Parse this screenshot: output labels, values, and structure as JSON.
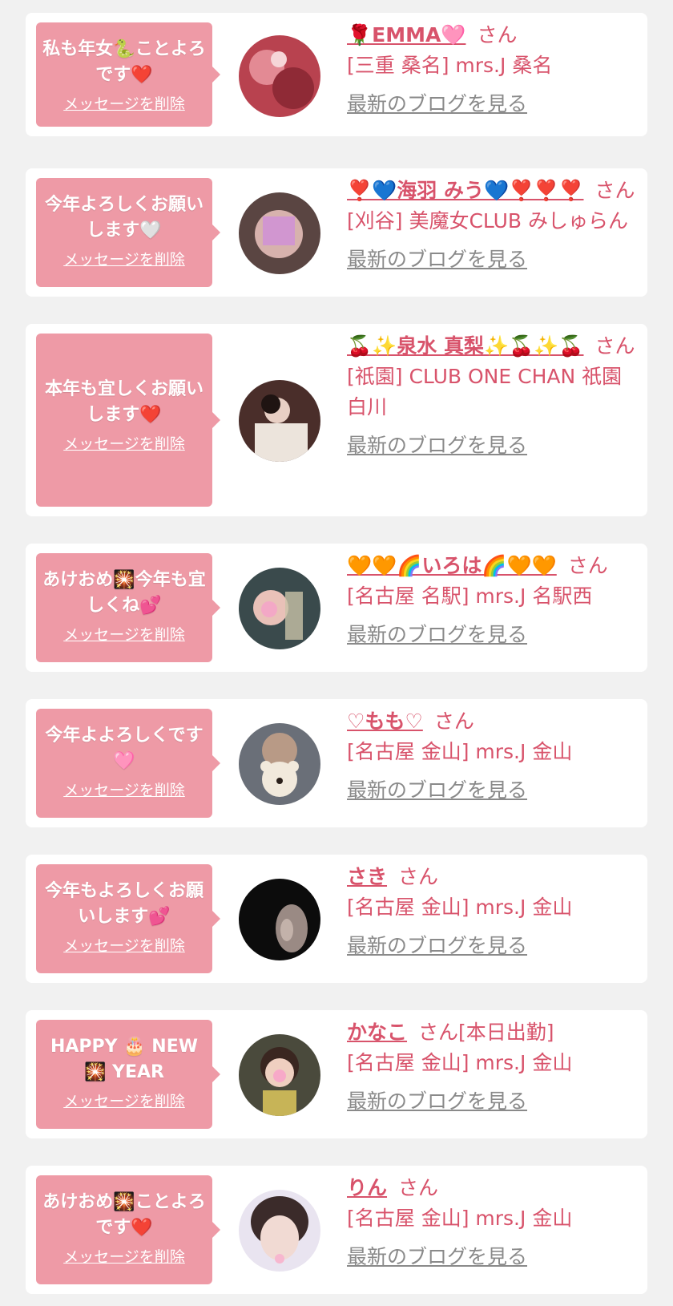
{
  "colors": {
    "background": "#f1f1f1",
    "card": "#ffffff",
    "bubble": "#ee9aa6",
    "accent": "#d8536b",
    "link_gray": "#8a8a8a"
  },
  "cards": [
    {
      "message": "私も年女🐍ことよろです❤️",
      "delete_label": "メッセージを削除",
      "name": "🌹EMMA🩷",
      "honorific": "さん",
      "status": "",
      "shop": "[三重 桑名] mrs.J 桑名",
      "blog_label": "最新のブログを見る"
    },
    {
      "message": "今年よろしくお願いします🤍",
      "delete_label": "メッセージを削除",
      "name": "❣️💙海羽 みう💙❣️❣️❣️",
      "honorific": "さん",
      "status": "",
      "shop": "[刈谷] 美魔女CLUB みしゅらん",
      "blog_label": "最新のブログを見る"
    },
    {
      "message": "本年も宜しくお願いします❤️",
      "delete_label": "メッセージを削除",
      "name": "🍒✨泉水 真梨✨🍒✨🍒",
      "honorific": "さん",
      "status": "",
      "shop": "[祇園] CLUB ONE CHAN 祇園白川",
      "blog_label": "最新のブログを見る"
    },
    {
      "message": "あけおめ🎇今年も宜しくね💕",
      "delete_label": "メッセージを削除",
      "name": "🧡🧡🌈いろは🌈🧡🧡",
      "honorific": "さん",
      "status": "",
      "shop": "[名古屋 名駅] mrs.J 名駅西",
      "blog_label": "最新のブログを見る"
    },
    {
      "message": "今年よよろしくです🩷",
      "delete_label": "メッセージを削除",
      "name": "♡もも♡",
      "honorific": "さん",
      "status": "",
      "shop": "[名古屋 金山] mrs.J 金山",
      "blog_label": "最新のブログを見る"
    },
    {
      "message": "今年もよろしくお願いします💕",
      "delete_label": "メッセージを削除",
      "name": "さき",
      "honorific": "さん",
      "status": "",
      "shop": "[名古屋 金山] mrs.J 金山",
      "blog_label": "最新のブログを見る"
    },
    {
      "message": "HAPPY 🎂 NEW 🎇 YEAR",
      "delete_label": "メッセージを削除",
      "name": "かなこ",
      "honorific": "さん",
      "status": "[本日出勤]",
      "shop": "[名古屋 金山] mrs.J 金山",
      "blog_label": "最新のブログを見る"
    },
    {
      "message": "あけおめ🎇ことよろです❤️",
      "delete_label": "メッセージを削除",
      "name": "りん",
      "honorific": "さん",
      "status": "",
      "shop": "[名古屋 金山] mrs.J 金山",
      "blog_label": "最新のブログを見る"
    }
  ]
}
